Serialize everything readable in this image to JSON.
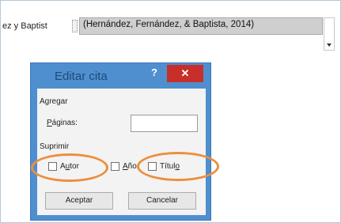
{
  "document": {
    "left_text": "ez y Baptist",
    "citation": "(Hernández, Fernández, & Baptista, 2014)"
  },
  "dialog": {
    "title": "Editar cita",
    "help": "?",
    "close": "✕",
    "add_section": "Agregar",
    "pages_label_first": "P",
    "pages_label_rest": "áginas:",
    "pages_value": "",
    "suppress_section": "Suprimir",
    "author_label_a": "A",
    "author_label_u": "u",
    "author_label_rest": "tor",
    "year_label_a": "A",
    "year_label_rest": "ño",
    "title_label_main": "Títul",
    "title_label_u": "o",
    "author_checked": false,
    "year_checked": false,
    "title_checked": false,
    "accept_button": "Aceptar",
    "cancel_button": "Cancelar"
  },
  "colors": {
    "highlight_oval": "#ec8f3e",
    "dialog_border": "#4f8fd0",
    "close_button": "#c7302a"
  }
}
